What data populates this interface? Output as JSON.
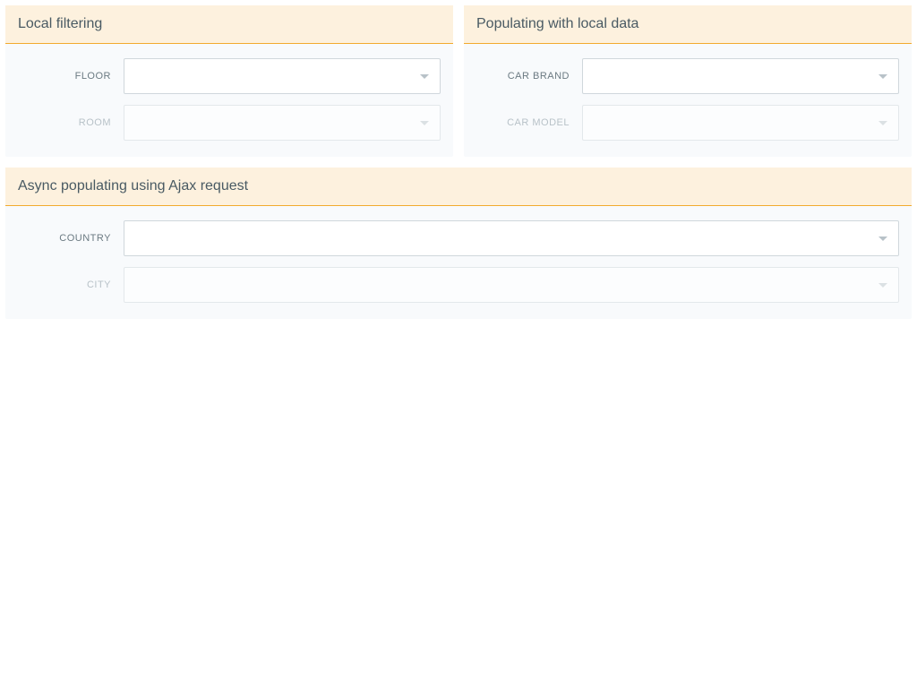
{
  "panels": {
    "localFiltering": {
      "title": "Local filtering",
      "fields": {
        "floor": {
          "label": "FLOOR",
          "value": "",
          "disabled": false
        },
        "room": {
          "label": "ROOM",
          "value": "",
          "disabled": true
        }
      }
    },
    "localData": {
      "title": "Populating with local data",
      "fields": {
        "carBrand": {
          "label": "CAR BRAND",
          "value": "",
          "disabled": false
        },
        "carModel": {
          "label": "CAR MODEL",
          "value": "",
          "disabled": true
        }
      }
    },
    "async": {
      "title": "Async populating using Ajax request",
      "fields": {
        "country": {
          "label": "COUNTRY",
          "value": "",
          "disabled": false
        },
        "city": {
          "label": "CITY",
          "value": "",
          "disabled": true
        }
      }
    }
  }
}
